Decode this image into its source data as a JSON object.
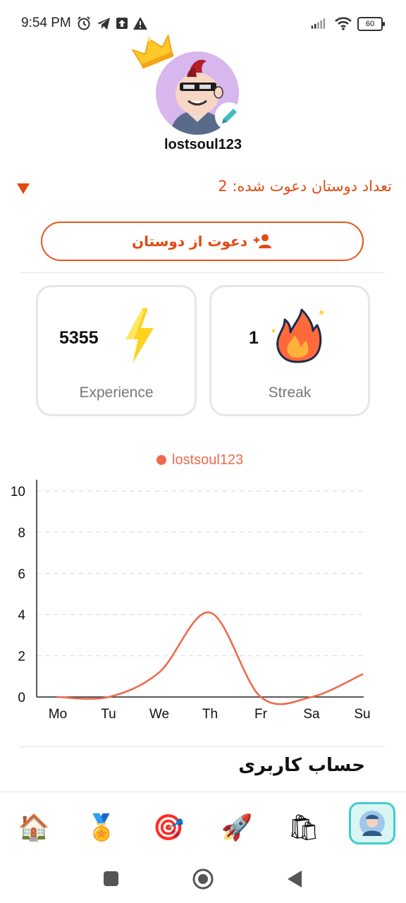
{
  "status_bar": {
    "time": "9:54 PM",
    "battery": "60",
    "icons": [
      "alarm-icon",
      "telegram-icon",
      "upload-icon",
      "warning-icon",
      "signal-icon",
      "wifi-icon"
    ]
  },
  "profile": {
    "username": "lostsoul123",
    "avatar_bg": "#d8b6ee",
    "edit_icon": "pencil-icon",
    "crown_icon": "crown-icon"
  },
  "invites": {
    "count_text": "تعداد دوستان دعوت شده: 2",
    "invite_button_label": "دعوت از دوستان",
    "invite_icon": "add-person-icon"
  },
  "stats": {
    "experience": {
      "value": "5355",
      "label": "Experience",
      "icon": "lightning-icon"
    },
    "streak": {
      "value": "1",
      "label": "Streak",
      "icon": "fire-icon"
    }
  },
  "chart_data": {
    "type": "line",
    "series": [
      {
        "name": "lostsoul123",
        "color": "#ef6a4c",
        "values": [
          0,
          0,
          1.2,
          4.1,
          0,
          0,
          1.1
        ]
      }
    ],
    "categories": [
      "Mo",
      "Tu",
      "We",
      "Th",
      "Fr",
      "Sa",
      "Su"
    ],
    "yticks": [
      "0",
      "2",
      "4",
      "6",
      "8",
      "10"
    ],
    "ylim": [
      0,
      10
    ],
    "grid": "dashed horizontal",
    "legend": "top-center"
  },
  "account": {
    "title": "حساب کاربری"
  },
  "bottom_nav": {
    "items": [
      {
        "name": "home-icon",
        "glyph": "🏠"
      },
      {
        "name": "medal-icon",
        "glyph": "🏅"
      },
      {
        "name": "target-icon",
        "glyph": "🎯"
      },
      {
        "name": "rocket-icon",
        "glyph": "🚀"
      },
      {
        "name": "shopping-bag-icon",
        "glyph": "🛍"
      },
      {
        "name": "profile-avatar-icon",
        "glyph": "👤"
      }
    ],
    "active": "profile-avatar-icon",
    "active_color": "#3fcdcc"
  }
}
